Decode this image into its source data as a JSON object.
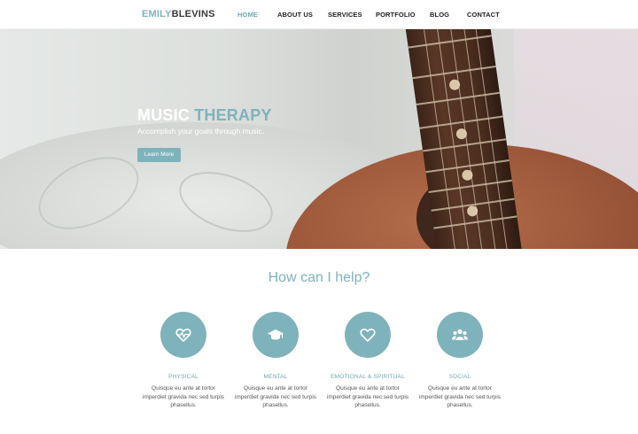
{
  "brand": {
    "first": "EMILY",
    "last": "BLEVINS"
  },
  "nav": {
    "items": [
      {
        "label": "HOME",
        "active": true
      },
      {
        "label": "ABOUT US",
        "active": false
      },
      {
        "label": "SERVICES",
        "active": false
      },
      {
        "label": "PORTFOLIO",
        "active": false
      },
      {
        "label": "BLOG",
        "active": false
      },
      {
        "label": "CONTACT",
        "active": false
      }
    ]
  },
  "hero": {
    "title_word1": "MUSIC",
    "title_word2": "THERAPY",
    "subtitle": "Accomplish your goals through music.",
    "button_label": "Learn More"
  },
  "help": {
    "title": "How can I help?",
    "cards": [
      {
        "icon": "heartbeat-icon",
        "title": "PHYSICAL",
        "text": "Quisque eu ante at tortor imperdiet gravida nec sed turpis phasellus."
      },
      {
        "icon": "graduation-cap-icon",
        "title": "MENTAL",
        "text": "Quisque eu ante at tortor imperdiet gravida nec sed turpis phasellus."
      },
      {
        "icon": "heart-icon",
        "title": "EMOTIONAL & SPIRITUAL",
        "text": "Quisque eu ante at tortor imperdiet gravida nec sed turpis phasellus."
      },
      {
        "icon": "users-icon",
        "title": "SOCIAL",
        "text": "Quisque eu ante at tortor imperdiet gravida nec sed turpis phasellus."
      }
    ]
  },
  "colors": {
    "accent": "#7fb3bc",
    "dark": "#3a3a3a"
  }
}
